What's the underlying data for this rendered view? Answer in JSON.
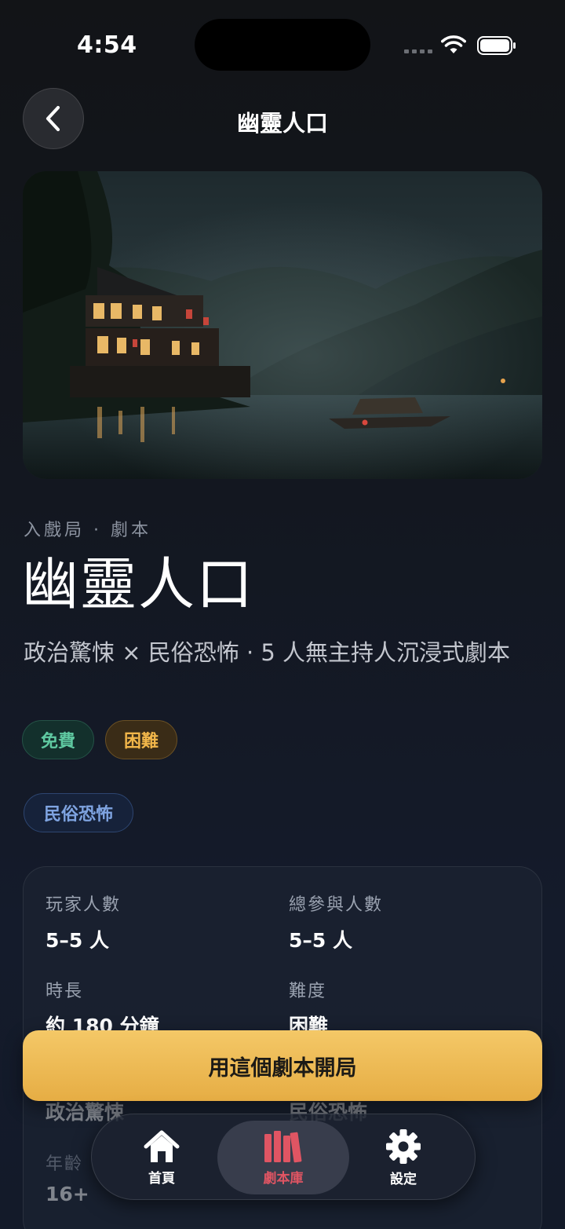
{
  "status_bar": {
    "time": "4:54"
  },
  "header": {
    "title": "幽靈人口",
    "back_icon": "chevron-left-icon"
  },
  "hero": {
    "alt_icon": "script-cover-image"
  },
  "meta": {
    "text": "入戲局 · 劇本"
  },
  "script": {
    "title": "幽靈人口",
    "subtitle": "政治驚悚 × 民俗恐怖 · 5 人無主持人沉浸式劇本"
  },
  "tags": {
    "price": "免費",
    "difficulty": "困難",
    "genre": "民俗恐怖"
  },
  "info": {
    "players_label": "玩家人數",
    "players_value": "5–5 人",
    "participants_label": "總參與人數",
    "participants_value": "5–5 人",
    "duration_label": "時長",
    "duration_value": "約 180 分鐘",
    "difficulty_label": "難度",
    "difficulty_value": "困難",
    "genre1_value": "政治驚悚",
    "genre2_value": "民俗恐怖",
    "age_label": "年齡",
    "age_value": "16+"
  },
  "cta": {
    "label": "用這個劇本開局"
  },
  "tabbar": {
    "items": [
      {
        "label": "首頁",
        "icon": "home-icon"
      },
      {
        "label": "劇本庫",
        "icon": "books-icon"
      },
      {
        "label": "設定",
        "icon": "gear-icon"
      }
    ],
    "active_index": 1
  },
  "colors": {
    "accent": "#f0bd56",
    "active_tab": "#e05563",
    "free": "#5fc9a1",
    "hard": "#f1b64a",
    "genre": "#7ea3e0"
  }
}
